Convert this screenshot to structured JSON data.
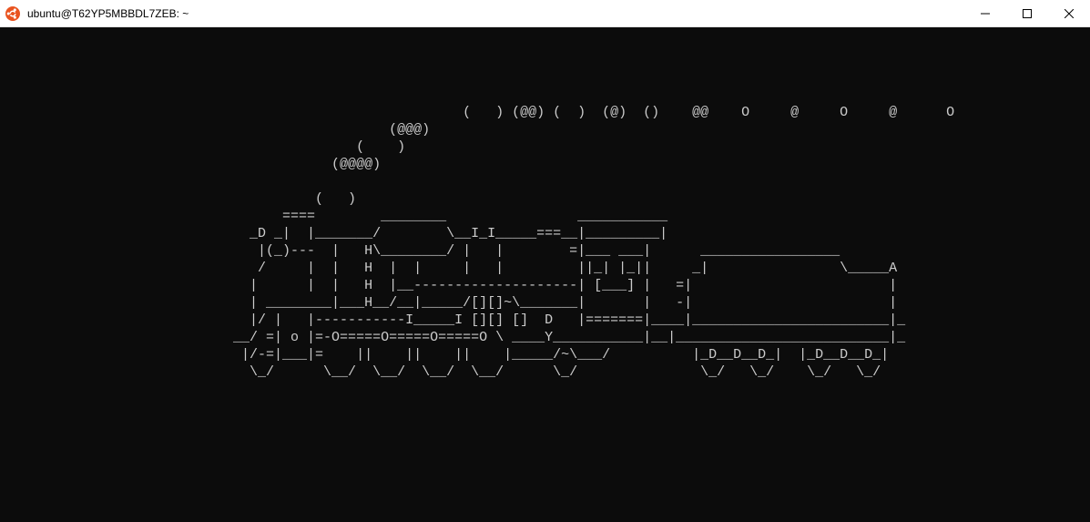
{
  "window": {
    "title": "ubuntu@T62YP5MBBDL7ZEB: ~",
    "icon_name": "ubuntu-logo-icon"
  },
  "controls": {
    "minimize": "Minimize",
    "maximize": "Maximize",
    "close": "Close"
  },
  "terminal": {
    "ascii_art": [
      "",
      "",
      "",
      "",
      "                                                        (   ) (@@) (  )  (@)  ()    @@    O     @     O     @      O",
      "                                               (@@@)",
      "                                           (    )",
      "                                        (@@@@)",
      "",
      "                                      (   )",
      "                                  ====        ________                ___________",
      "                              _D _|  |_______/        \\__I_I_____===__|_________|",
      "                               |(_)---  |   H\\________/ |   |        =|___ ___|      _________________",
      "                               /     |  |   H  |  |     |   |         ||_| |_||     _|                \\_____A",
      "                              |      |  |   H  |__--------------------| [___] |   =|                        |",
      "                              | ________|___H__/__|_____/[][]~\\_______|       |   -|                        |",
      "                              |/ |   |-----------I_____I [][] []  D   |=======|____|________________________|_",
      "                            __/ =| o |=-O=====O=====O=====O \\ ____Y___________|__|__________________________|_",
      "                             |/-=|___|=    ||    ||    ||    |_____/~\\___/          |_D__D__D_|  |_D__D__D_|",
      "                              \\_/      \\__/  \\__/  \\__/  \\__/      \\_/               \\_/   \\_/    \\_/   \\_/"
    ]
  }
}
